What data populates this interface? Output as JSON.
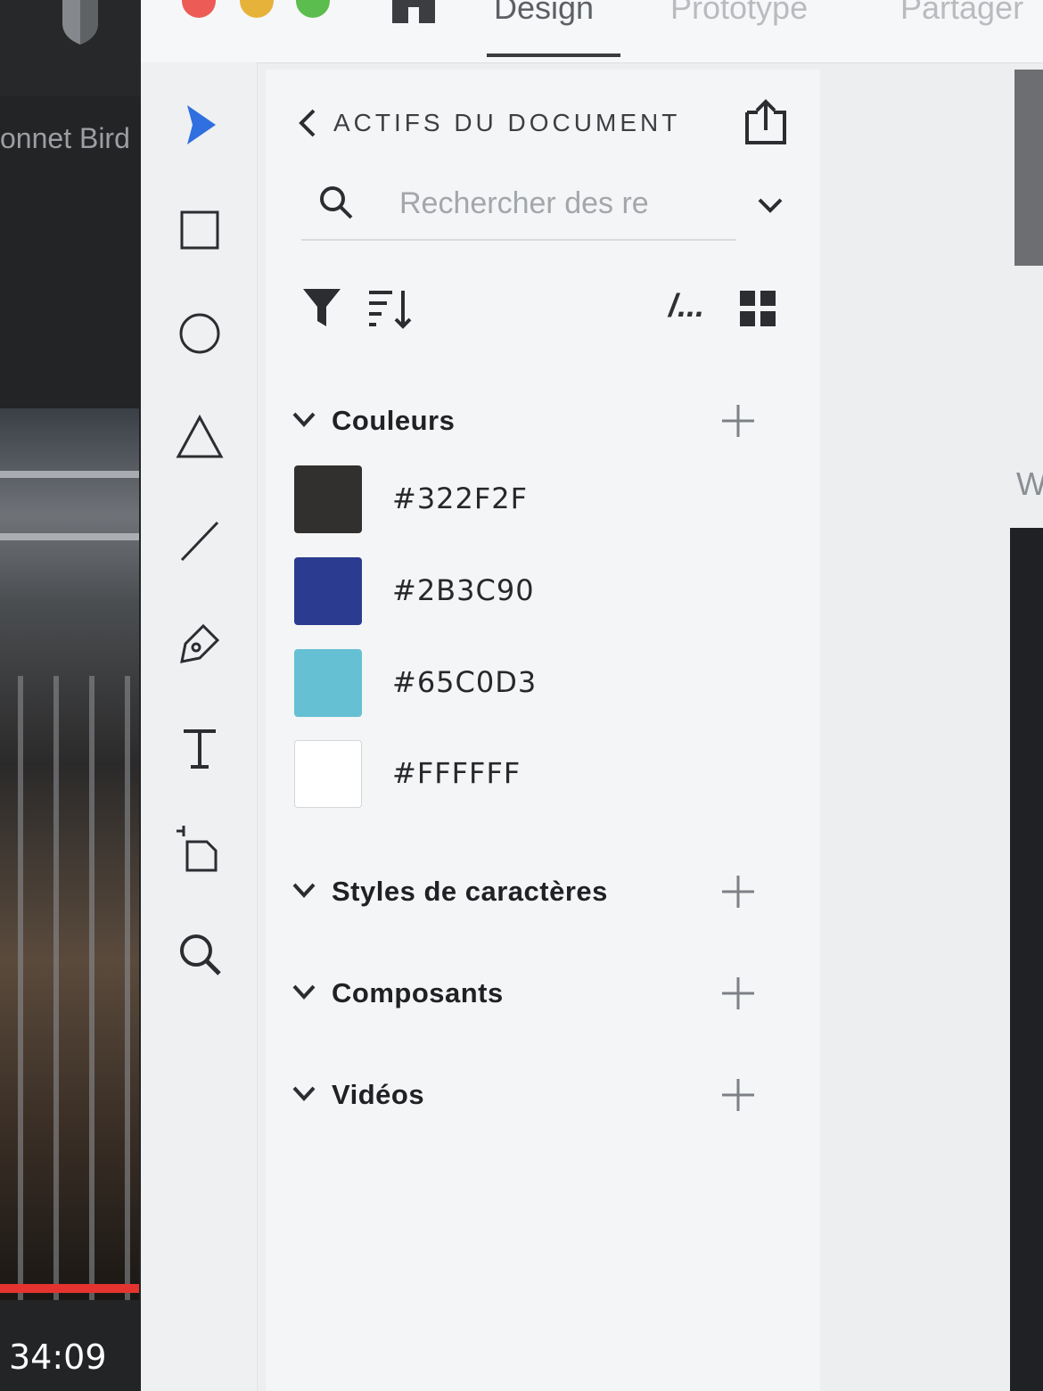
{
  "background_window": {
    "title": "onnet Bird",
    "timestamp": "34:09",
    "progress_color": "#e5342f"
  },
  "titlebar": {
    "traffic_lights": [
      "#ec5b55",
      "#e7b23a",
      "#5bbd4e"
    ],
    "home_icon": "home-icon",
    "tabs": [
      {
        "label": "Design",
        "active": true
      },
      {
        "label": "Prototype",
        "active": false
      },
      {
        "label": "Partager",
        "active": false
      }
    ]
  },
  "toolbar": {
    "tools": [
      "select-icon",
      "rectangle-icon",
      "ellipse-icon",
      "polygon-icon",
      "line-icon",
      "pen-icon",
      "text-icon",
      "artboard-icon",
      "zoom-icon"
    ],
    "accent": "#2f6fe0"
  },
  "assets_panel": {
    "title": "ACTIFS DU DOCUMENT",
    "search": {
      "placeholder": "Rechercher des re",
      "value": ""
    },
    "path_label": "/...",
    "sections": {
      "colors": {
        "label": "Couleurs",
        "items": [
          {
            "hex": "#322F2F",
            "color": "#322F2F"
          },
          {
            "hex": "#2B3C90",
            "color": "#2B3C90"
          },
          {
            "hex": "#65C0D3",
            "color": "#65C0D3"
          },
          {
            "hex": "#FFFFFF",
            "color": "#FFFFFF"
          }
        ]
      },
      "char_styles": {
        "label": "Styles de caractères"
      },
      "components": {
        "label": "Composants"
      },
      "videos": {
        "label": "Vidéos"
      }
    }
  },
  "canvas": {
    "edge_text": "W"
  }
}
